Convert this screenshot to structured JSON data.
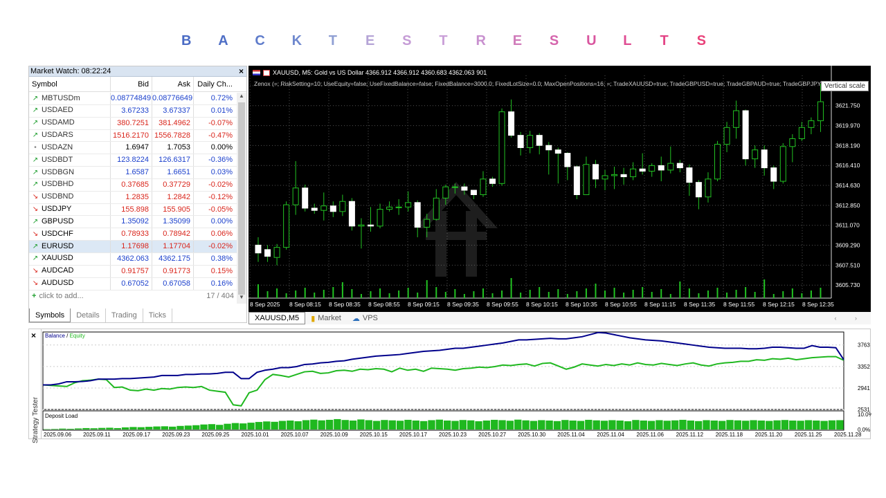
{
  "title": [
    "B",
    "A",
    "C",
    "K",
    "T",
    "E",
    "S",
    "T",
    "R",
    "E",
    "S",
    "U",
    "L",
    "T",
    "S"
  ],
  "title_colors": [
    "#4a6bc4",
    "#4f6fc6",
    "#5f7ccb",
    "#6f88ce",
    "#8f9fd3",
    "#b5a4d6",
    "#c59cd6",
    "#caa0d8",
    "#c890cf",
    "#d07bba",
    "#d565ad",
    "#d9569f",
    "#df4c93",
    "#e34586",
    "#e9427a"
  ],
  "market_watch": {
    "title": "Market Watch: 08:22:24",
    "close": "×",
    "headers": {
      "symbol": "Symbol",
      "bid": "Bid",
      "ask": "Ask",
      "change": "Daily Ch..."
    },
    "rows": [
      {
        "symbol": "MBTUSDm",
        "bid": "0.08774849",
        "ask": "0.08776649",
        "change": "0.72%",
        "dir": "up",
        "color": "blue",
        "bold": false
      },
      {
        "symbol": "USDAED",
        "bid": "3.67233",
        "ask": "3.67337",
        "change": "0.01%",
        "dir": "up",
        "color": "blue",
        "bold": false
      },
      {
        "symbol": "USDAMD",
        "bid": "380.7251",
        "ask": "381.4962",
        "change": "-0.07%",
        "dir": "up",
        "color": "red",
        "bold": false
      },
      {
        "symbol": "USDARS",
        "bid": "1516.2170",
        "ask": "1556.7828",
        "change": "-0.47%",
        "dir": "up",
        "color": "red",
        "bold": false
      },
      {
        "symbol": "USDAZN",
        "bid": "1.6947",
        "ask": "1.7053",
        "change": "0.00%",
        "dir": "dot",
        "color": "black",
        "bold": false
      },
      {
        "symbol": "USDBDT",
        "bid": "123.8224",
        "ask": "126.6317",
        "change": "-0.36%",
        "dir": "up",
        "color": "blue",
        "bold": false
      },
      {
        "symbol": "USDBGN",
        "bid": "1.6587",
        "ask": "1.6651",
        "change": "0.03%",
        "dir": "up",
        "color": "blue",
        "bold": false
      },
      {
        "symbol": "USDBHD",
        "bid": "0.37685",
        "ask": "0.37729",
        "change": "-0.02%",
        "dir": "up",
        "color": "red",
        "bold": false
      },
      {
        "symbol": "USDBND",
        "bid": "1.2835",
        "ask": "1.2842",
        "change": "-0.12%",
        "dir": "down",
        "color": "red",
        "bold": false
      },
      {
        "symbol": "USDJPY",
        "bid": "155.898",
        "ask": "155.905",
        "change": "-0.05%",
        "dir": "down",
        "color": "red",
        "bold": true
      },
      {
        "symbol": "GBPUSD",
        "bid": "1.35092",
        "ask": "1.35099",
        "change": "0.00%",
        "dir": "up",
        "color": "blue",
        "bold": true
      },
      {
        "symbol": "USDCHF",
        "bid": "0.78933",
        "ask": "0.78942",
        "change": "0.06%",
        "dir": "down",
        "color": "red",
        "bold": true
      },
      {
        "symbol": "EURUSD",
        "bid": "1.17698",
        "ask": "1.17704",
        "change": "-0.02%",
        "dir": "up",
        "color": "red",
        "bold": true
      },
      {
        "symbol": "XAUUSD",
        "bid": "4362.063",
        "ask": "4362.175",
        "change": "0.38%",
        "dir": "up",
        "color": "blue",
        "bold": true
      },
      {
        "symbol": "AUDCAD",
        "bid": "0.91757",
        "ask": "0.91773",
        "change": "0.15%",
        "dir": "down",
        "color": "red",
        "bold": true
      },
      {
        "symbol": "AUDUSD",
        "bid": "0.67052",
        "ask": "0.67058",
        "change": "0.16%",
        "dir": "down",
        "color": "blue",
        "bold": true
      }
    ],
    "add_label": "click to add...",
    "count": "17 / 404",
    "tabs": [
      "Symbols",
      "Details",
      "Trading",
      "Ticks"
    ]
  },
  "chart": {
    "header": "XAUUSD, M5:  Gold vs US Dollar  4366.912 4366.912 4360.683 4362.063  901",
    "params": "Zenox (=; RiskSetting=10; UseEquity=false; UseFixedBalance=false; FixedBalance=3000.0; FixedLotSize=0.0; MaxOpenPositions=16; =; TradeXAUUSD=true; TradeGBPUSD=true; TradeGBPAUD=true; TradeGBPJPY=true;",
    "tooltip": "Vertical scale",
    "price_labels": [
      "3623.530",
      "3621.750",
      "3619.970",
      "3618.190",
      "3616.410",
      "3614.630",
      "3612.850",
      "3611.070",
      "3609.290",
      "3607.510",
      "3605.730"
    ],
    "time_labels": [
      "8 Sep 2025",
      "8 Sep 08:15",
      "8 Sep 08:35",
      "8 Sep 08:55",
      "8 Sep 09:15",
      "8 Sep 09:35",
      "8 Sep 09:55",
      "8 Sep 10:15",
      "8 Sep 10:35",
      "8 Sep 10:55",
      "8 Sep 11:15",
      "8 Sep 11:35",
      "8 Sep 11:55",
      "8 Sep 12:15",
      "8 Sep 12:35"
    ],
    "tabs": [
      "XAUUSD,M5",
      "Market",
      "VPS"
    ],
    "nav_arrows": "‹ ›",
    "candles": [
      [
        3609.3,
        3608.6,
        3610.0,
        3607.8
      ],
      [
        3608.9,
        3608.3,
        3609.3,
        3607.8
      ],
      [
        3608.2,
        3609.1,
        3609.4,
        3607.5
      ],
      [
        3609.1,
        3612.9,
        3613.2,
        3608.9
      ],
      [
        3612.9,
        3614.4,
        3616.8,
        3612.0
      ],
      [
        3614.4,
        3612.6,
        3614.7,
        3612.3
      ],
      [
        3612.6,
        3612.4,
        3613.0,
        3612.1
      ],
      [
        3612.4,
        3612.8,
        3614.0,
        3611.5
      ],
      [
        3612.8,
        3612.3,
        3613.2,
        3611.8
      ],
      [
        3612.3,
        3613.2,
        3613.8,
        3611.9
      ],
      [
        3613.2,
        3611.0,
        3613.5,
        3610.6
      ],
      [
        3611.0,
        3611.1,
        3611.7,
        3609.0
      ],
      [
        3611.1,
        3611.0,
        3612.7,
        3610.5
      ],
      [
        3611.0,
        3612.5,
        3613.0,
        3610.8
      ],
      [
        3612.5,
        3612.7,
        3613.2,
        3612.3
      ],
      [
        3612.7,
        3612.7,
        3613.4,
        3612.0
      ],
      [
        3612.7,
        3613.1,
        3614.1,
        3612.3
      ],
      [
        3613.1,
        3610.9,
        3613.3,
        3610.0
      ],
      [
        3610.9,
        3611.6,
        3612.1,
        3610.0
      ],
      [
        3611.6,
        3613.5,
        3614.3,
        3611.5
      ],
      [
        3613.5,
        3614.5,
        3614.7,
        3612.9
      ],
      [
        3614.5,
        3614.5,
        3614.8,
        3613.9
      ],
      [
        3614.5,
        3614.2,
        3614.8,
        3613.8
      ],
      [
        3614.2,
        3613.8,
        3614.2,
        3613.4
      ],
      [
        3613.8,
        3615.2,
        3615.9,
        3613.6
      ],
      [
        3615.2,
        3614.8,
        3615.4,
        3614.5
      ],
      [
        3614.8,
        3621.2,
        3621.5,
        3614.6
      ],
      [
        3621.2,
        3619.1,
        3622.3,
        3618.9
      ],
      [
        3619.1,
        3618.0,
        3619.4,
        3617.3
      ],
      [
        3618.0,
        3619.1,
        3619.5,
        3617.5
      ],
      [
        3619.1,
        3618.2,
        3619.3,
        3617.4
      ],
      [
        3618.2,
        3617.8,
        3618.5,
        3615.6
      ],
      [
        3617.8,
        3617.5,
        3618.0,
        3614.8
      ],
      [
        3617.5,
        3616.3,
        3617.6,
        3615.1
      ],
      [
        3616.3,
        3613.8,
        3616.4,
        3613.4
      ],
      [
        3613.8,
        3616.5,
        3617.2,
        3613.8
      ],
      [
        3616.5,
        3615.2,
        3616.9,
        3614.4
      ],
      [
        3615.2,
        3615.5,
        3616.0,
        3614.2
      ],
      [
        3615.5,
        3615.6,
        3616.3,
        3614.3
      ],
      [
        3615.6,
        3615.4,
        3616.2,
        3614.7
      ],
      [
        3615.4,
        3616.1,
        3616.7,
        3615.1
      ],
      [
        3616.1,
        3615.9,
        3617.5,
        3615.6
      ],
      [
        3615.9,
        3616.4,
        3616.6,
        3615.4
      ],
      [
        3616.4,
        3616.0,
        3617.2,
        3615.0
      ],
      [
        3616.0,
        3616.6,
        3618.1,
        3615.7
      ],
      [
        3616.6,
        3616.2,
        3616.9,
        3615.8
      ],
      [
        3616.2,
        3614.9,
        3616.5,
        3613.7
      ],
      [
        3614.9,
        3613.6,
        3615.1,
        3612.5
      ],
      [
        3613.6,
        3615.2,
        3615.8,
        3613.1
      ],
      [
        3615.2,
        3618.3,
        3618.6,
        3615.0
      ],
      [
        3618.3,
        3619.8,
        3620.3,
        3617.6
      ],
      [
        3619.8,
        3621.3,
        3622.2,
        3618.8
      ],
      [
        3621.3,
        3617.0,
        3621.4,
        3616.4
      ],
      [
        3617.0,
        3617.8,
        3618.2,
        3616.2
      ],
      [
        3617.8,
        3616.2,
        3618.2,
        3615.5
      ],
      [
        3616.2,
        3615.0,
        3616.4,
        3614.3
      ],
      [
        3615.0,
        3618.1,
        3618.4,
        3614.8
      ],
      [
        3618.1,
        3618.8,
        3619.2,
        3616.7
      ],
      [
        3618.8,
        3619.8,
        3620.3,
        3618.6
      ],
      [
        3619.8,
        3620.4,
        3620.7,
        3619.2
      ],
      [
        3620.4,
        3622.1,
        3623.7,
        3619.4
      ]
    ],
    "ylim": [
      3604.57,
      3624.45
    ]
  },
  "tester": {
    "legend_balance": "Balance",
    "legend_sep": " / ",
    "legend_equity": "Equity",
    "deposit_label": "Deposit Load",
    "side_label": "Strategy Tester",
    "close": "×",
    "y_labels": [
      "3763",
      "3352",
      "2941",
      "2531"
    ],
    "dep_labels": [
      "10.0%",
      "0.0%"
    ],
    "x_labels": [
      "2025.09.06",
      "2025.09.11",
      "2025.09.17",
      "2025.09.23",
      "2025.09.25",
      "2025.10.01",
      "2025.10.07",
      "2025.10.09",
      "2025.10.15",
      "2025.10.17",
      "2025.10.23",
      "2025.10.27",
      "2025.10.30",
      "2025.11.04",
      "2025.11.04",
      "2025.11.06",
      "2025.11.12",
      "2025.11.18",
      "2025.11.20",
      "2025.11.25",
      "2025.11.28"
    ],
    "balance": [
      3000,
      3000,
      3020,
      3060,
      3060,
      3065,
      3080,
      3110,
      3110,
      3110,
      3120,
      3120,
      3130,
      3140,
      3150,
      3180,
      3180,
      3180,
      3200,
      3200,
      3210,
      3210,
      3220,
      3240,
      3240,
      3120,
      3120,
      3240,
      3280,
      3300,
      3330,
      3330,
      3350,
      3390,
      3400,
      3420,
      3430,
      3450,
      3460,
      3490,
      3510,
      3530,
      3550,
      3560,
      3570,
      3580,
      3600,
      3620,
      3640,
      3650,
      3660,
      3680,
      3700,
      3700,
      3720,
      3740,
      3760,
      3780,
      3800,
      3830,
      3860,
      3860,
      3870,
      3880,
      3890,
      3880,
      3880,
      3900,
      3920,
      3960,
      4000,
      3990,
      3960,
      3930,
      3900,
      3880,
      3860,
      3850,
      3840,
      3820,
      3800,
      3780,
      3760,
      3740,
      3720,
      3710,
      3700,
      3700,
      3700,
      3690,
      3690,
      3700,
      3720,
      3720,
      3710,
      3700,
      3700,
      3750,
      3720,
      3720,
      3710,
      3480
    ],
    "equity": [
      3000,
      2990,
      2980,
      2970,
      3040,
      3080,
      3090,
      3110,
      3100,
      2950,
      2960,
      2900,
      2890,
      2920,
      2900,
      2930,
      2920,
      2950,
      2960,
      2950,
      2970,
      2900,
      2880,
      2860,
      2620,
      2600,
      2850,
      2900,
      3100,
      3200,
      3180,
      3150,
      3200,
      3250,
      3260,
      3220,
      3230,
      3270,
      3280,
      3260,
      3300,
      3290,
      3310,
      3300,
      3250,
      3320,
      3280,
      3300,
      3260,
      3320,
      3310,
      3300,
      3280,
      3310,
      3320,
      3340,
      3330,
      3350,
      3380,
      3370,
      3390,
      3400,
      3360,
      3410,
      3420,
      3360,
      3300,
      3340,
      3400,
      3380,
      3360,
      3390,
      3370,
      3400,
      3380,
      3420,
      3390,
      3380,
      3410,
      3390,
      3370,
      3400,
      3420,
      3380,
      3360,
      3400,
      3420,
      3430,
      3450,
      3450,
      3480,
      3470,
      3500,
      3490,
      3510,
      3480,
      3500,
      3520,
      3530,
      3540,
      3540,
      3470
    ],
    "deposit_load": [
      0.2,
      0.3,
      0.5,
      0.4,
      0.6,
      0.8,
      0.7,
      0.9,
      1.0,
      0.8,
      1.2,
      1.4,
      1.3,
      1.5,
      1.7,
      1.8,
      1.6,
      2.0,
      2.2,
      2.4,
      2.8,
      3.0,
      2.6,
      3.2,
      3.6,
      3.4,
      3.8,
      4.2,
      4.5,
      4.3,
      4.8,
      5.0,
      4.6,
      5.2,
      5.5,
      5.1,
      5.4,
      5.8,
      5.3,
      5.0,
      5.6,
      5.2,
      4.8,
      5.3,
      5.1,
      4.9,
      5.4,
      5.0,
      4.7,
      5.2,
      5.5,
      5.0,
      4.8,
      5.3,
      5.1,
      4.6,
      5.0,
      5.4,
      5.2,
      4.9,
      5.5,
      5.1,
      4.8,
      5.2,
      5.0,
      4.7,
      5.3,
      5.0,
      4.8,
      5.4,
      5.1,
      4.9,
      5.2,
      5.0,
      4.6,
      5.3,
      5.0,
      4.8,
      5.2,
      4.9,
      5.1,
      5.4,
      5.0,
      4.7,
      5.2,
      5.0,
      4.8,
      5.3,
      5.1,
      4.9,
      5.2,
      5.0,
      4.8,
      5.1,
      5.3,
      5.0,
      4.9,
      5.2,
      5.0,
      4.8,
      5.1,
      5.2
    ],
    "balance_color": "#00008b",
    "equity_color": "#1fb81f"
  }
}
